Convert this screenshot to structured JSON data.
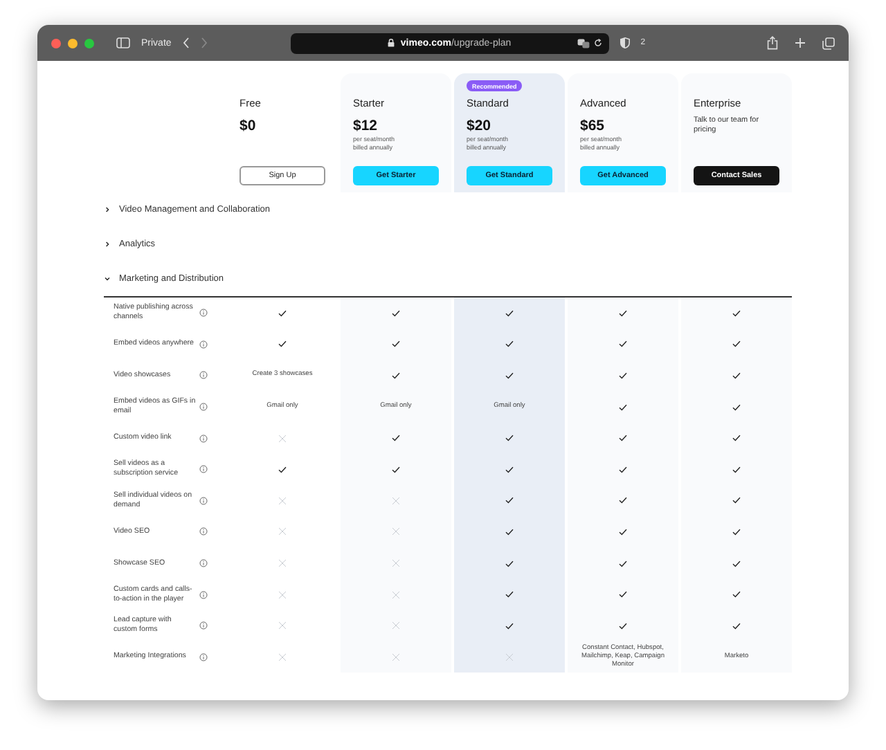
{
  "browser": {
    "mode": "Private",
    "url": "**vimeo.com**/upgrade-plan",
    "shield_count": "2"
  },
  "plans": [
    {
      "name": "Free",
      "price": "$0",
      "button": {
        "label": "Sign Up",
        "kind": "outline"
      }
    },
    {
      "name": "Starter",
      "price": "$12",
      "note": "per seat/month billed annually",
      "button": {
        "label": "Get Starter",
        "kind": "primary"
      }
    },
    {
      "name": "Standard",
      "badge": "Recommended",
      "highlighted": true,
      "price": "$20",
      "note": "per seat/month billed annually",
      "button": {
        "label": "Get Standard",
        "kind": "primary"
      }
    },
    {
      "name": "Advanced",
      "price": "$65",
      "note": "per seat/month billed annually",
      "button": {
        "label": "Get Advanced",
        "kind": "primary"
      }
    },
    {
      "name": "Enterprise",
      "description": "Talk to our team for pricing",
      "button": {
        "label": "Contact Sales",
        "kind": "dark"
      }
    }
  ],
  "sections": [
    {
      "title": "Video Management and Collaboration",
      "expanded": false
    },
    {
      "title": "Analytics",
      "expanded": false
    },
    {
      "title": "Marketing and Distribution",
      "expanded": true,
      "rows": [
        {
          "feature": "Native publishing across channels",
          "cells": [
            {
              "kind": "check"
            },
            {
              "kind": "check"
            },
            {
              "kind": "check"
            },
            {
              "kind": "check"
            },
            {
              "kind": "check"
            }
          ]
        },
        {
          "feature": "Embed videos anywhere",
          "cells": [
            {
              "kind": "check"
            },
            {
              "kind": "check"
            },
            {
              "kind": "check"
            },
            {
              "kind": "check"
            },
            {
              "kind": "check"
            }
          ]
        },
        {
          "feature": "Video showcases",
          "cells": [
            {
              "kind": "text",
              "text": "Create 3 showcases"
            },
            {
              "kind": "check"
            },
            {
              "kind": "check"
            },
            {
              "kind": "check"
            },
            {
              "kind": "check"
            }
          ]
        },
        {
          "feature": "Embed videos as GIFs in email",
          "cells": [
            {
              "kind": "text",
              "text": "Gmail only"
            },
            {
              "kind": "text",
              "text": "Gmail only"
            },
            {
              "kind": "text",
              "text": "Gmail only"
            },
            {
              "kind": "check"
            },
            {
              "kind": "check"
            }
          ]
        },
        {
          "feature": "Custom video link",
          "cells": [
            {
              "kind": "cross"
            },
            {
              "kind": "check"
            },
            {
              "kind": "check"
            },
            {
              "kind": "check"
            },
            {
              "kind": "check"
            }
          ]
        },
        {
          "feature": "Sell videos as a subscription service",
          "cells": [
            {
              "kind": "check"
            },
            {
              "kind": "check"
            },
            {
              "kind": "check"
            },
            {
              "kind": "check"
            },
            {
              "kind": "check"
            }
          ]
        },
        {
          "feature": "Sell individual videos on demand",
          "cells": [
            {
              "kind": "cross"
            },
            {
              "kind": "cross"
            },
            {
              "kind": "check"
            },
            {
              "kind": "check"
            },
            {
              "kind": "check"
            }
          ]
        },
        {
          "feature": "Video SEO",
          "cells": [
            {
              "kind": "cross"
            },
            {
              "kind": "cross"
            },
            {
              "kind": "check"
            },
            {
              "kind": "check"
            },
            {
              "kind": "check"
            }
          ]
        },
        {
          "feature": "Showcase SEO",
          "cells": [
            {
              "kind": "cross"
            },
            {
              "kind": "cross"
            },
            {
              "kind": "check"
            },
            {
              "kind": "check"
            },
            {
              "kind": "check"
            }
          ]
        },
        {
          "feature": "Custom cards and calls-to-action in the player",
          "cells": [
            {
              "kind": "cross"
            },
            {
              "kind": "cross"
            },
            {
              "kind": "check"
            },
            {
              "kind": "check"
            },
            {
              "kind": "check"
            }
          ]
        },
        {
          "feature": "Lead capture with custom forms",
          "cells": [
            {
              "kind": "cross"
            },
            {
              "kind": "cross"
            },
            {
              "kind": "check"
            },
            {
              "kind": "check"
            },
            {
              "kind": "check"
            }
          ]
        },
        {
          "feature": "Marketing Integrations",
          "cells": [
            {
              "kind": "cross"
            },
            {
              "kind": "cross"
            },
            {
              "kind": "cross"
            },
            {
              "kind": "text",
              "text": "Constant Contact, Hubspot, Mailchimp, Keap, Campaign Monitor"
            },
            {
              "kind": "text",
              "text": "Marketo"
            }
          ]
        }
      ]
    }
  ]
}
